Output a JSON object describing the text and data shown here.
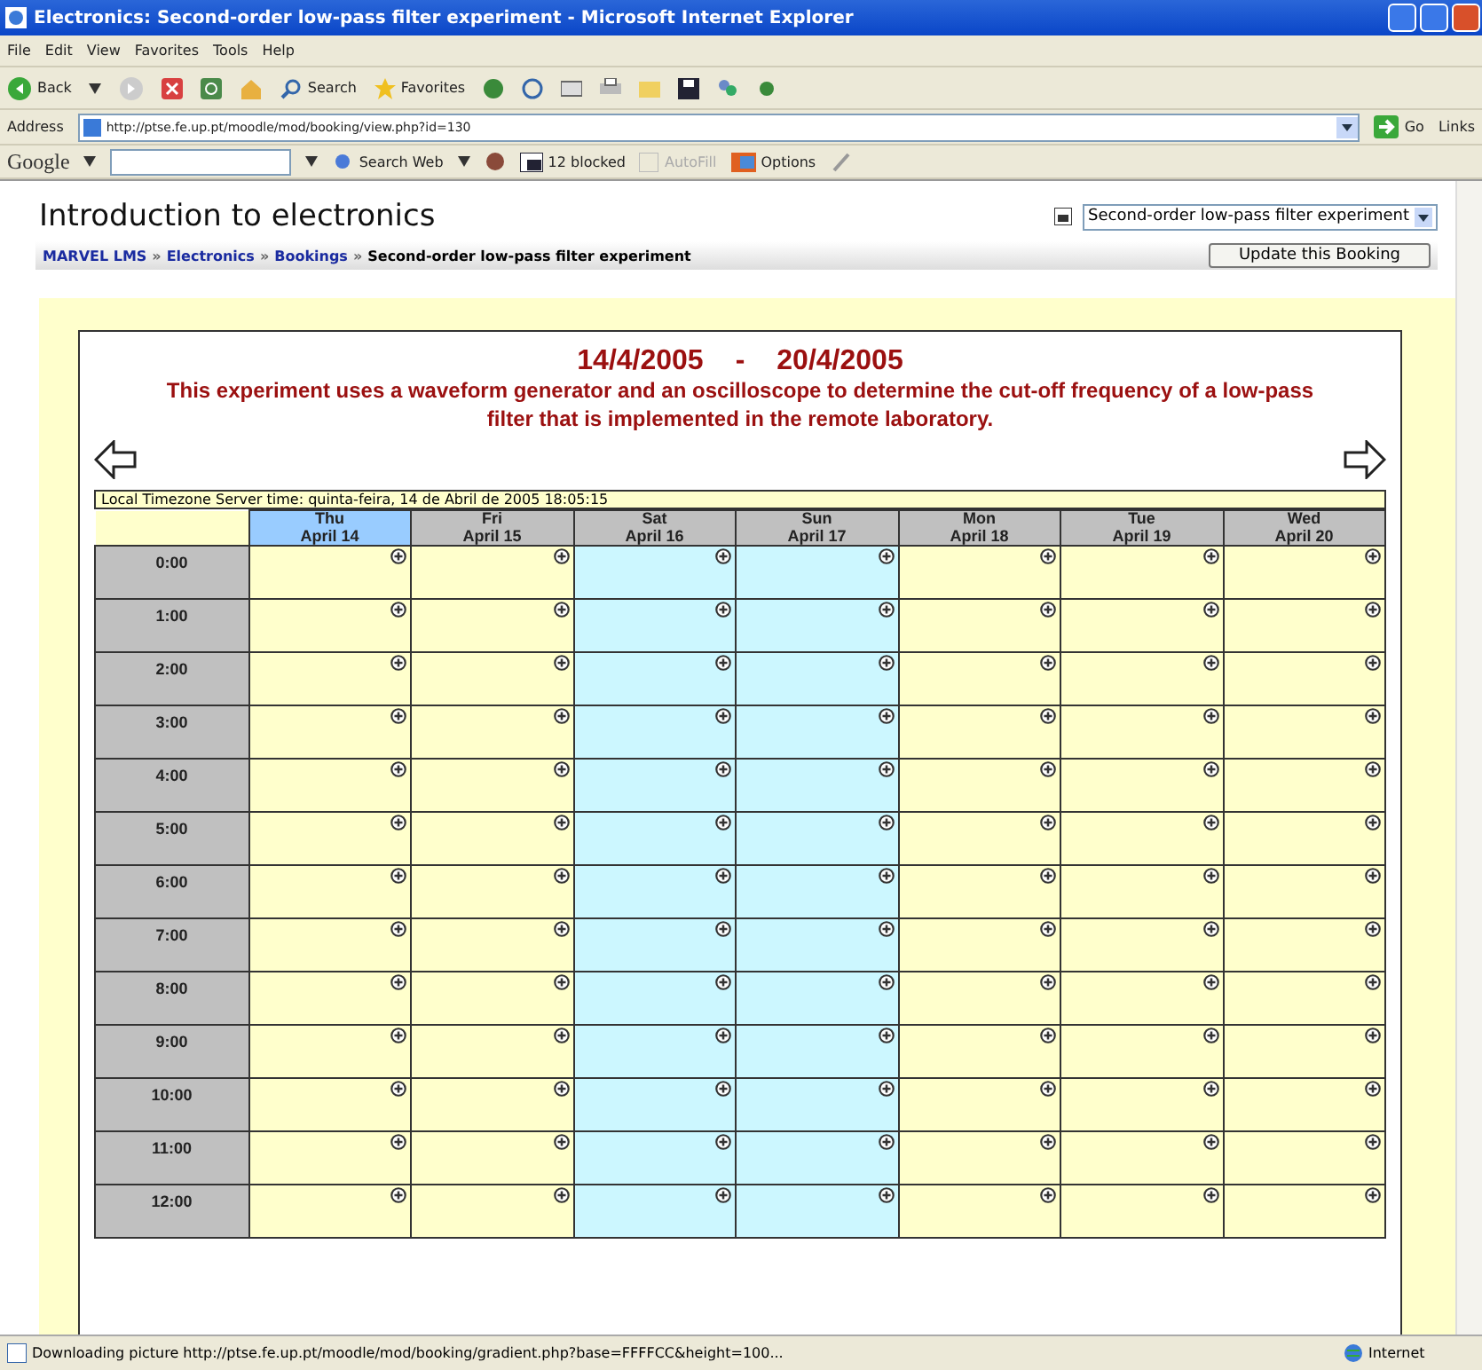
{
  "window": {
    "title": "Electronics: Second-order low-pass filter experiment - Microsoft Internet Explorer"
  },
  "menu": [
    "File",
    "Edit",
    "View",
    "Favorites",
    "Tools",
    "Help"
  ],
  "toolbar": {
    "back": "Back",
    "search": "Search",
    "favorites": "Favorites"
  },
  "address": {
    "label": "Address",
    "url": "http://ptse.fe.up.pt/moodle/mod/booking/view.php?id=130",
    "go": "Go",
    "links": "Links"
  },
  "google_bar": {
    "logo": "Google",
    "search_web": "Search Web",
    "blocked": "12 blocked",
    "autofill": {
      "label": "AutoFill",
      "disabled": true
    },
    "options": "Options"
  },
  "page": {
    "heading": "Introduction to electronics",
    "jump_select": "Second-order low-pass filter experiment",
    "breadcrumb_separator": "»",
    "breadcrumb": [
      {
        "text": "MARVEL LMS",
        "link": true
      },
      {
        "text": "Electronics",
        "link": true
      },
      {
        "text": "Bookings",
        "link": true
      },
      {
        "text": "Second-order low-pass filter experiment",
        "link": false
      }
    ],
    "update_button": "Update this Booking"
  },
  "calendar": {
    "date_from": "14/4/2005",
    "separator": "-",
    "date_to": "20/4/2005",
    "description": "This experiment uses a waveform generator and an oscilloscope to determine the cut-off frequency of a low-pass filter that is implemented in the remote laboratory.",
    "server_time": "Local Timezone Server time: quinta-feira, 14 de Abril de 2005 18:05:15",
    "days": [
      {
        "weekday": "Thu",
        "date": "April 14",
        "weekend": false,
        "selected": true
      },
      {
        "weekday": "Fri",
        "date": "April 15",
        "weekend": false,
        "selected": false
      },
      {
        "weekday": "Sat",
        "date": "April 16",
        "weekend": true,
        "selected": false
      },
      {
        "weekday": "Sun",
        "date": "April 17",
        "weekend": true,
        "selected": false
      },
      {
        "weekday": "Mon",
        "date": "April 18",
        "weekend": false,
        "selected": false
      },
      {
        "weekday": "Tue",
        "date": "April 19",
        "weekend": false,
        "selected": false
      },
      {
        "weekday": "Wed",
        "date": "April 20",
        "weekend": false,
        "selected": false
      }
    ],
    "hours": [
      "0:00",
      "1:00",
      "2:00",
      "3:00",
      "4:00",
      "5:00",
      "6:00",
      "7:00",
      "8:00",
      "9:00",
      "10:00",
      "11:00",
      "12:00"
    ]
  },
  "status_bar": {
    "text": "Downloading picture http://ptse.fe.up.pt/moodle/mod/booking/gradient.php?base=FFFFCC&height=100...",
    "zone": "Internet"
  }
}
